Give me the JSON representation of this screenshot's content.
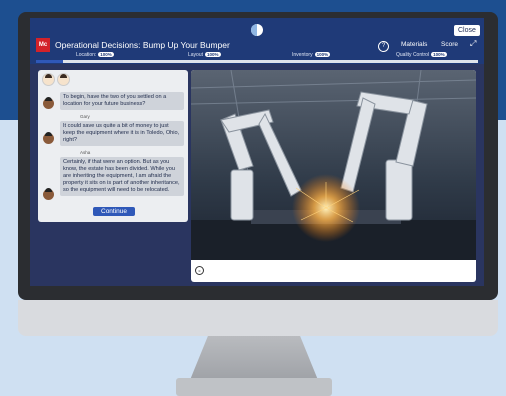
{
  "header": {
    "title": "Operational Decisions: Bump Up Your Bumper",
    "close_label": "Close",
    "help_label": "?",
    "materials_label": "Materials",
    "score_label": "Score",
    "logo_text": "Mc"
  },
  "stats": [
    {
      "label": "Location:",
      "value": "100%"
    },
    {
      "label": "Layout",
      "value": "100%"
    },
    {
      "label": "Inventory",
      "value": "100%"
    },
    {
      "label": "Quality Control",
      "value": "100%"
    }
  ],
  "progress": {
    "fraction": 0.06
  },
  "chat": {
    "messages": [
      {
        "speaker": "",
        "text": "To begin, have the two of you settled on a location for your future business?"
      },
      {
        "speaker": "Gary",
        "text": "It could save us quite a bit of money to just keep the equipment where it is in Toledo, Ohio, right?"
      },
      {
        "speaker": "Asha",
        "text": "Certainly, if that were an option. But as you know, the estate has been divided. While you are inheriting the equipment, I am afraid the property it sits on is part of another inheritance, so the equipment will need to be relocated."
      }
    ],
    "continue_label": "Continue"
  },
  "icons": {
    "spinner": "loading-icon",
    "help": "help-icon",
    "expand": "expand-icon",
    "caption": "caption-icon"
  },
  "colors": {
    "header": "#1f3a78",
    "accent": "#2f58b8",
    "brand_logo": "#d3222a"
  }
}
